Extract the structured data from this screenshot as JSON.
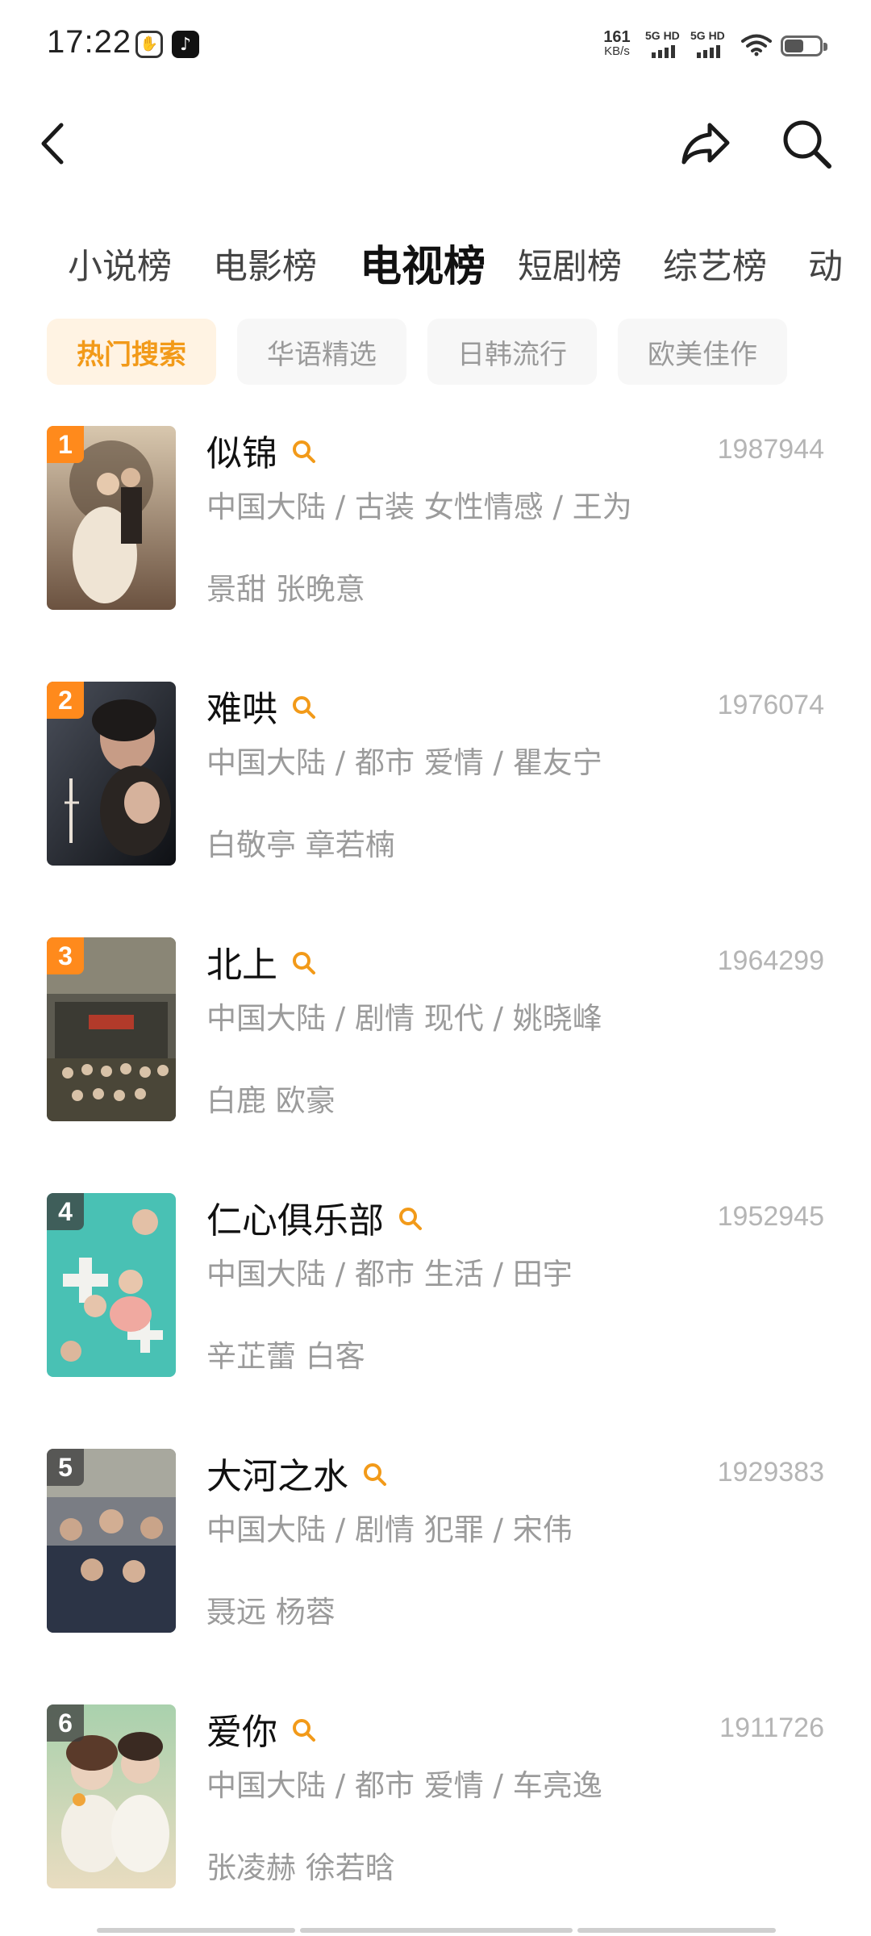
{
  "status": {
    "time": "17:22",
    "speed_value": "161",
    "speed_unit": "KB/s",
    "sim1_label": "5G HD",
    "sim2_label": "5G HD",
    "battery_level": 0.55
  },
  "nav": {
    "back_icon": "chevron-left-icon",
    "share_icon": "share-arrow-icon",
    "search_icon": "search-icon"
  },
  "category_tabs": [
    {
      "label": "小说榜"
    },
    {
      "label": "电影榜"
    },
    {
      "label": "电视榜",
      "active": true
    },
    {
      "label": "短剧榜"
    },
    {
      "label": "综艺榜"
    },
    {
      "label": "动"
    }
  ],
  "filter_chips": [
    {
      "label": "热门搜索",
      "active": true
    },
    {
      "label": "华语精选"
    },
    {
      "label": "日韩流行"
    },
    {
      "label": "欧美佳作"
    }
  ],
  "items": [
    {
      "rank": "1",
      "title": "似锦",
      "count": "1987944",
      "meta_line1": "中国大陆 / 古装 女性情感 / 王为",
      "meta_line2": "景甜 张晚意",
      "poster_colors": [
        "#c9b39a",
        "#6b5240"
      ]
    },
    {
      "rank": "2",
      "title": "难哄",
      "count": "1976074",
      "meta_line1": "中国大陆 / 都市 爱情 / 瞿友宁",
      "meta_line2": "白敬亭 章若楠",
      "poster_colors": [
        "#3a3f4a",
        "#121418"
      ]
    },
    {
      "rank": "3",
      "title": "北上",
      "count": "1964299",
      "meta_line1": "中国大陆 / 剧情 现代 / 姚晓峰",
      "meta_line2": "白鹿 欧豪",
      "poster_colors": [
        "#6e6a5e",
        "#3a3a32"
      ]
    },
    {
      "rank": "4",
      "title": "仁心俱乐部",
      "count": "1952945",
      "meta_line1": "中国大陆 / 都市 生活 / 田宇",
      "meta_line2": "辛芷蕾 白客",
      "poster_colors": [
        "#49c1b4",
        "#e9b8b0"
      ]
    },
    {
      "rank": "5",
      "title": "大河之水",
      "count": "1929383",
      "meta_line1": "中国大陆 / 剧情 犯罪 / 宋伟",
      "meta_line2": "聂远 杨蓉",
      "poster_colors": [
        "#6b6f78",
        "#2a3142"
      ]
    },
    {
      "rank": "6",
      "title": "爱你",
      "count": "1911726",
      "meta_line1": "中国大陆 / 都市 爱情 / 车亮逸",
      "meta_line2": "张凌赫 徐若晗",
      "poster_colors": [
        "#9cc7a4",
        "#e8d6b4"
      ]
    }
  ],
  "colors": {
    "accent": "#f29a19",
    "rank_badge": "#ff8a1c",
    "muted_text": "#9b9b9b"
  }
}
